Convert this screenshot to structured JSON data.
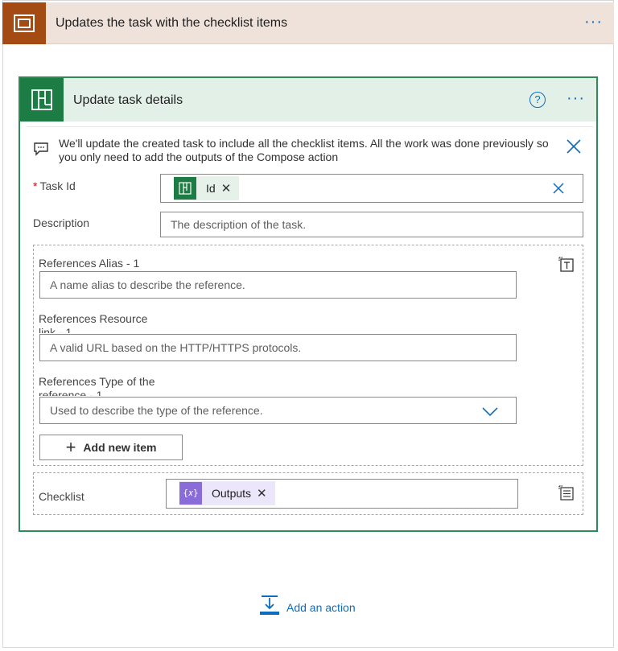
{
  "scope": {
    "title": "Updates the task with the checklist items",
    "more_label": "···"
  },
  "action": {
    "title": "Update task details",
    "help_label": "?",
    "more_label": "···",
    "comment": "We'll update the created task to include all the checklist items. All the work was done previously so you only need to add the outputs of the Compose action",
    "fields": {
      "task_id": {
        "required_mark": "*",
        "label": "Task Id",
        "token_label": "Id",
        "token_remove": "✕"
      },
      "description": {
        "label": "Description",
        "placeholder": "The description of the task."
      },
      "references": {
        "alias": {
          "label": "References Alias - 1",
          "placeholder": "A name alias to describe the reference."
        },
        "resource_link": {
          "label": "References Resource link - 1",
          "placeholder": "A valid URL based on the HTTP/HTTPS protocols."
        },
        "type": {
          "label": "References Type of the reference - 1",
          "placeholder": "Used to describe the type of the reference."
        },
        "add_new_item": "Add new item"
      },
      "checklist": {
        "label": "Checklist",
        "token_label": "Outputs",
        "token_remove": "✕"
      }
    }
  },
  "footer": {
    "add_action": "Add an action"
  },
  "colors": {
    "scope_accent": "#a44a13",
    "scope_header_bg": "#efe2db",
    "action_accent": "#1d7b44",
    "action_header_bg": "#e3f0e8",
    "link_blue": "#0f6cbd",
    "compose_token": "#8a6cd8"
  },
  "icons": {
    "scope": "scope-icon",
    "planner": "planner-icon",
    "help": "help-icon",
    "comment": "comment-icon",
    "close": "close-icon",
    "clear": "clear-icon",
    "switch_input_mode": "switch-input-mode-icon",
    "chevron": "chevron-down-icon",
    "plus": "plus-icon",
    "compose": "compose-icon",
    "add_action": "add-action-icon"
  }
}
